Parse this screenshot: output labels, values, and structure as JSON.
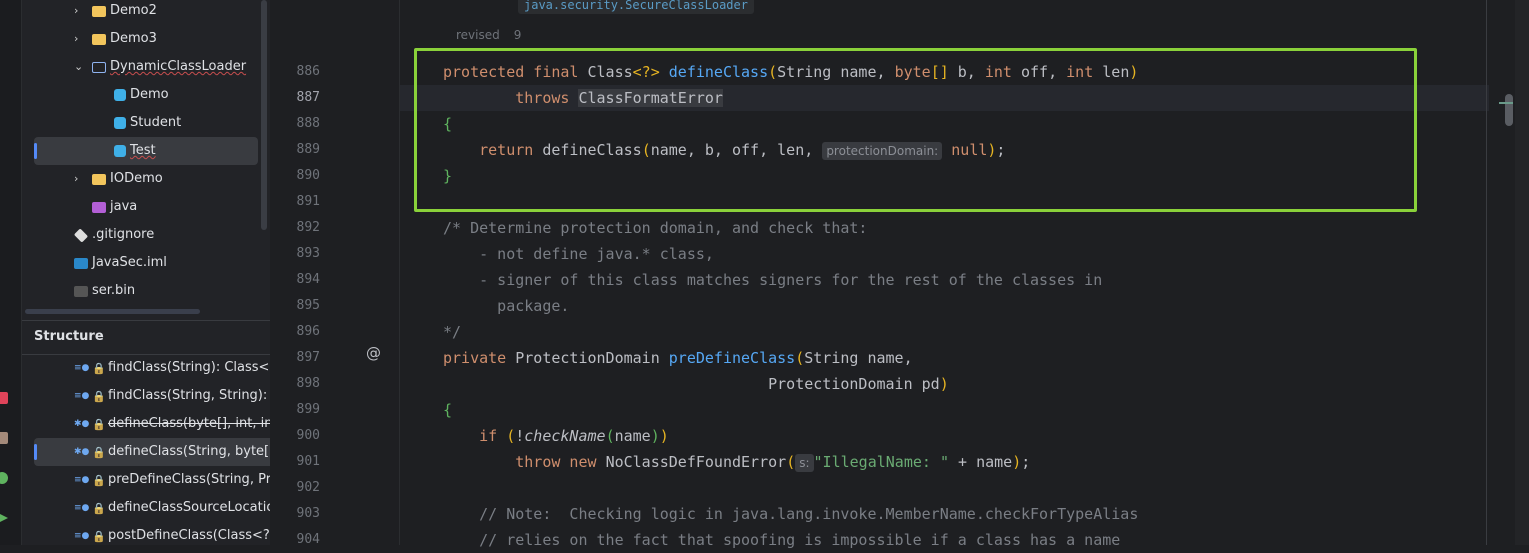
{
  "project_tree": [
    {
      "label": "Demo2",
      "type": "folder",
      "expanded": false
    },
    {
      "label": "Demo3",
      "type": "folder",
      "expanded": false
    },
    {
      "label": "DynamicClassLoader",
      "type": "package",
      "expanded": true
    },
    {
      "label": "Demo",
      "type": "class"
    },
    {
      "label": "Student",
      "type": "class"
    },
    {
      "label": "Test",
      "type": "class",
      "selected": true
    },
    {
      "label": "IODemo",
      "type": "folder",
      "expanded": false
    },
    {
      "label": "java",
      "type": "resource-folder"
    },
    {
      "label": ".gitignore",
      "type": "git-file"
    },
    {
      "label": "JavaSec.iml",
      "type": "iml-file"
    },
    {
      "label": "ser.bin",
      "type": "binary-file"
    }
  ],
  "structure": {
    "title": "Structure",
    "items": [
      {
        "label": "findClass(String): Class<?>",
        "access": "protected"
      },
      {
        "label": "findClass(String, String): Class<?>",
        "access": "protected"
      },
      {
        "label": "defineClass(byte[], int, int): Class<?>",
        "access": "protected",
        "deprecated": true
      },
      {
        "label": "defineClass(String, byte[], int, int): Class<?>",
        "access": "protected",
        "selected": true
      },
      {
        "label": "preDefineClass(String, ProtectionDomain)",
        "access": "private"
      },
      {
        "label": "defineClassSourceLocation(ProtectionDomain)",
        "access": "private"
      },
      {
        "label": "postDefineClass(Class<?>, ProtectionDomain)",
        "access": "private"
      }
    ]
  },
  "editor": {
    "doc_tooltip": "java.security.SecureClassLoader",
    "revised_label": "revised",
    "revised_value": "9",
    "current_line": "887",
    "annotation_gutter_icon": "@",
    "colors": {
      "highlight_box": "#8ad13a",
      "keyword": "#cf8e6d",
      "function": "#56a8f5",
      "comment": "#7a7e85",
      "string": "#6aab73"
    },
    "lines": [
      {
        "n": "886",
        "t": [
          [
            "kw",
            "protected final "
          ],
          [
            "",
            "Class"
          ],
          [
            "br",
            "<?>"
          ],
          [
            "",
            " "
          ],
          [
            "fn",
            "defineClass"
          ],
          [
            "br",
            "("
          ],
          [
            "",
            "String name, "
          ],
          [
            "kw",
            "byte"
          ],
          [
            "br",
            "[]"
          ],
          [
            "",
            " b, "
          ],
          [
            "kw",
            "int"
          ],
          [
            "",
            " off, "
          ],
          [
            "kw",
            "int"
          ],
          [
            "",
            " len"
          ],
          [
            "br",
            ")"
          ]
        ]
      },
      {
        "n": "887",
        "t": [
          [
            "",
            "        "
          ],
          [
            "kw",
            "throws "
          ],
          [
            "hl",
            "ClassFormatError"
          ]
        ]
      },
      {
        "n": "888",
        "t": [
          [
            "gr",
            "{"
          ]
        ]
      },
      {
        "n": "889",
        "t": [
          [
            "",
            "    "
          ],
          [
            "kw",
            "return "
          ],
          [
            "",
            "defineClass"
          ],
          [
            "br",
            "("
          ],
          [
            "",
            "name, b, off, len, "
          ],
          [
            "hint",
            "protectionDomain:"
          ],
          [
            "kw",
            " null"
          ],
          [
            "br",
            ")"
          ],
          [
            "",
            ";"
          ]
        ]
      },
      {
        "n": "890",
        "t": [
          [
            "gr",
            "}"
          ]
        ]
      },
      {
        "n": "891",
        "t": []
      },
      {
        "n": "892",
        "t": [
          [
            "cm",
            "/* Determine protection domain, and check that:"
          ]
        ]
      },
      {
        "n": "893",
        "t": [
          [
            "cm",
            "    - not define java.* class,"
          ]
        ]
      },
      {
        "n": "894",
        "t": [
          [
            "cm",
            "    - signer of this class matches signers for the rest of the classes in"
          ]
        ]
      },
      {
        "n": "895",
        "t": [
          [
            "cm",
            "      package."
          ]
        ]
      },
      {
        "n": "896",
        "t": [
          [
            "cm",
            "*/"
          ]
        ]
      },
      {
        "n": "897",
        "t": [
          [
            "kw",
            "private "
          ],
          [
            "",
            "ProtectionDomain "
          ],
          [
            "fn",
            "preDefineClass"
          ],
          [
            "br",
            "("
          ],
          [
            "",
            "String name,"
          ]
        ]
      },
      {
        "n": "898",
        "t": [
          [
            "",
            "                                    ProtectionDomain pd"
          ],
          [
            "br",
            ")"
          ]
        ]
      },
      {
        "n": "899",
        "t": [
          [
            "gr",
            "{"
          ]
        ]
      },
      {
        "n": "900",
        "t": [
          [
            "",
            "    "
          ],
          [
            "kw",
            "if "
          ],
          [
            "br",
            "("
          ],
          [
            "",
            "!"
          ],
          [
            "it",
            "checkName"
          ],
          [
            "gr",
            "("
          ],
          [
            "",
            "name"
          ],
          [
            "gr",
            ")"
          ],
          [
            "br",
            ")"
          ]
        ]
      },
      {
        "n": "901",
        "t": [
          [
            "",
            "        "
          ],
          [
            "kw",
            "throw new "
          ],
          [
            "",
            "NoClassDefFoundError"
          ],
          [
            "br",
            "("
          ],
          [
            "hint",
            "s:"
          ],
          [
            "st",
            "\"IllegalName: \""
          ],
          [
            "",
            " + name"
          ],
          [
            "br",
            ")"
          ],
          [
            "",
            ";"
          ]
        ]
      },
      {
        "n": "902",
        "t": []
      },
      {
        "n": "903",
        "t": [
          [
            "cm",
            "    // Note:  Checking logic in java.lang.invoke.MemberName.checkForTypeAlias"
          ]
        ]
      },
      {
        "n": "904",
        "t": [
          [
            "cm",
            "    // relies on the fact that spoofing is impossible if a class has a name"
          ]
        ]
      }
    ]
  }
}
